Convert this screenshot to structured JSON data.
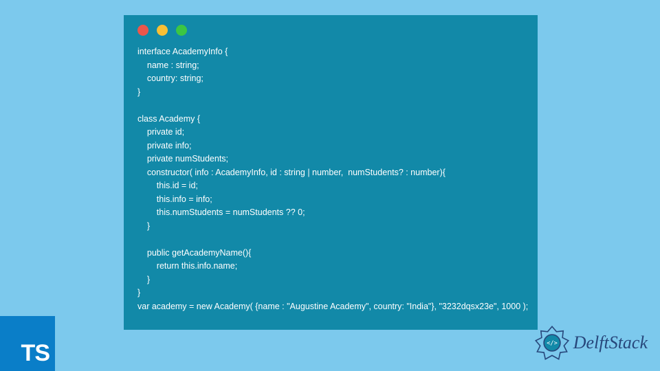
{
  "code": "interface AcademyInfo {\n    name : string;\n    country: string;\n}\n\nclass Academy {\n    private id;\n    private info;\n    private numStudents;\n    constructor( info : AcademyInfo, id : string | number,  numStudents? : number){\n        this.id = id;\n        this.info = info;\n        this.numStudents = numStudents ?? 0;\n    }\n\n    public getAcademyName(){\n        return this.info.name;\n    }\n}\nvar academy = new Academy( {name : \"Augustine Academy\", country: \"India\"}, \"3232dqsx23e\", 1000 );",
  "ts_badge": "TS",
  "brand": "DelftStack"
}
